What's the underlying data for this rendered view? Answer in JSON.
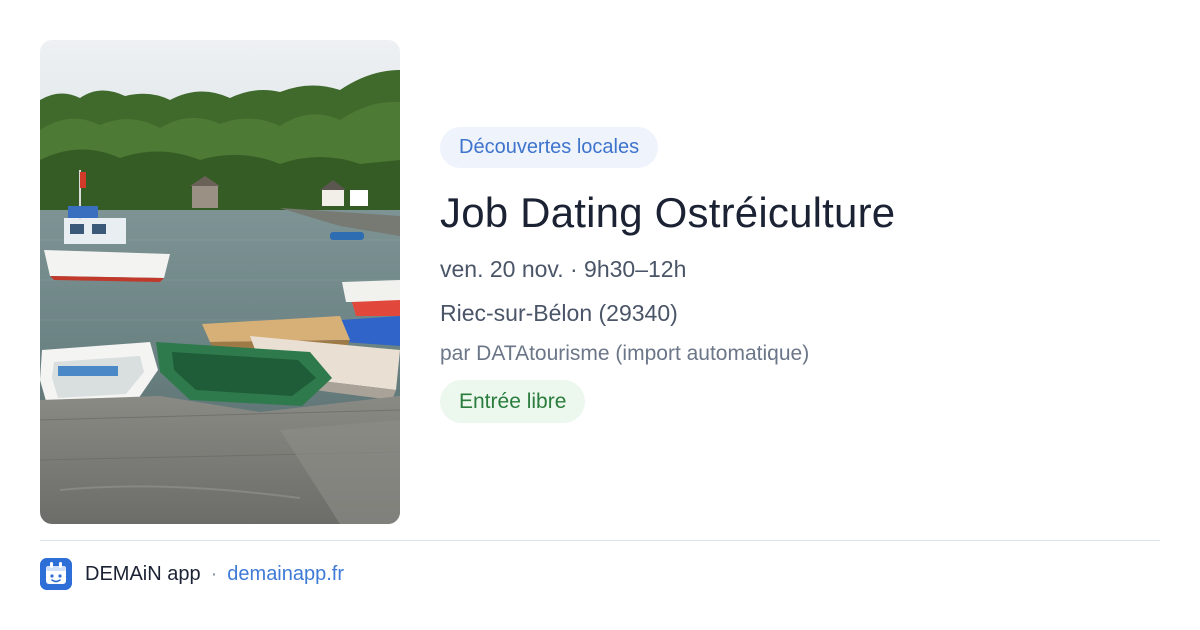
{
  "event": {
    "category": "Découvertes locales",
    "title": "Job Dating Ostréiculture",
    "datetime": "ven. 20 nov. · 9h30–12h",
    "location": "Riec-sur-Bélon (29340)",
    "organizer": "par DATAtourisme (import automatique)",
    "price": "Entrée libre",
    "photo_icon": "harbor-photo-icon"
  },
  "footer": {
    "app_name": "DEMAiN app",
    "separator": "·",
    "domain": "demainapp.fr",
    "logo_icon": "demain-app-logo-icon"
  },
  "colors": {
    "category_chip_bg": "#eef3fc",
    "category_chip_text": "#3e74cc",
    "price_chip_bg": "#ecf8ee",
    "price_chip_text": "#2a7d3c",
    "title_text": "#1b2233",
    "link": "#3e7ad6"
  }
}
